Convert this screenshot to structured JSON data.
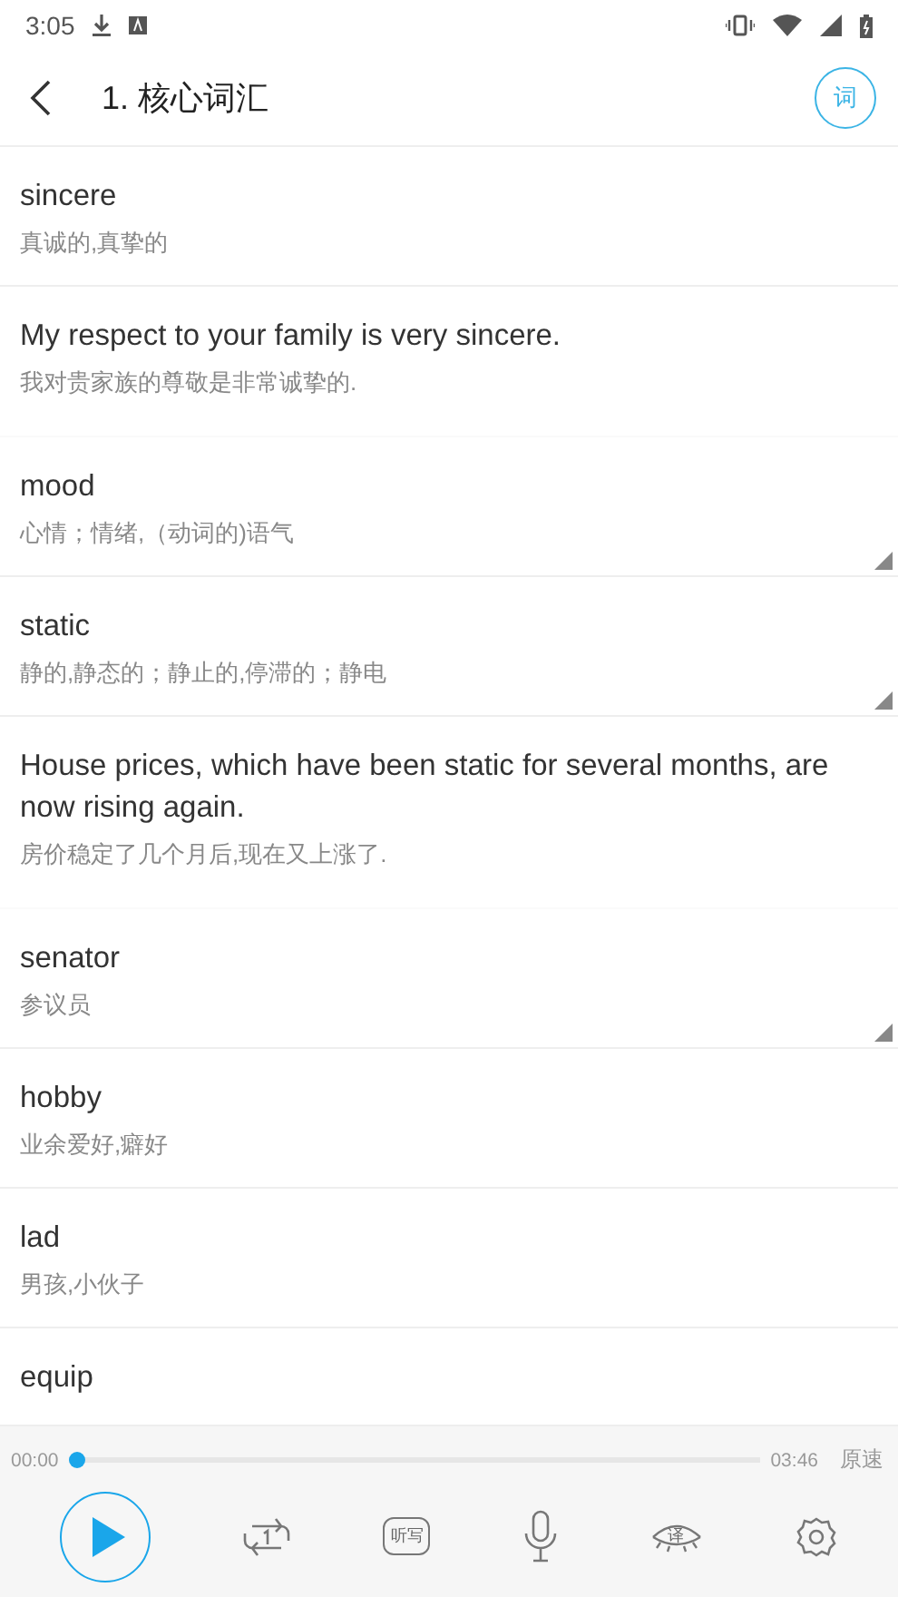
{
  "status_bar": {
    "time": "3:05"
  },
  "header": {
    "title": "1. 核心词汇",
    "badge": "词"
  },
  "entries": [
    {
      "kind": "word",
      "text": "sincere",
      "meaning": "真诚的,真挚的",
      "expandable": false
    },
    {
      "kind": "sentence",
      "text": "My respect to your family is very sincere.",
      "meaning": "我对贵家族的尊敬是非常诚挚的.",
      "expandable": false
    },
    {
      "kind": "word",
      "text": "mood",
      "meaning": "心情；情绪,（动词的)语气",
      "expandable": true
    },
    {
      "kind": "word",
      "text": "static",
      "meaning": "静的,静态的；静止的,停滞的；静电",
      "expandable": true
    },
    {
      "kind": "sentence",
      "text": "House prices, which have been static for several months, are now rising again.",
      "meaning": "房价稳定了几个月后,现在又上涨了.",
      "expandable": false
    },
    {
      "kind": "word",
      "text": "senator",
      "meaning": "参议员",
      "expandable": true
    },
    {
      "kind": "word",
      "text": "hobby",
      "meaning": "业余爱好,癖好",
      "expandable": false
    },
    {
      "kind": "word",
      "text": "lad",
      "meaning": "男孩,小伙子",
      "expandable": false
    },
    {
      "kind": "word",
      "text": "equip",
      "expandable": false
    }
  ],
  "player": {
    "elapsed": "00:00",
    "level": 0,
    "total": "03:46",
    "speed": "原速",
    "dictation_label": "听写",
    "translate_label": "译"
  }
}
